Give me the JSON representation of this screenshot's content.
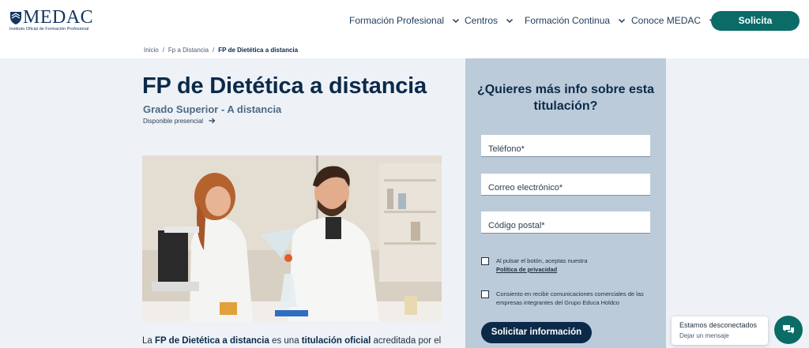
{
  "header": {
    "logo": {
      "word": "MEDAC",
      "tagline": "Instituto Oficial de Formación Profesional"
    },
    "nav": [
      {
        "label": "Formación Profesional"
      },
      {
        "label": "Centros"
      },
      {
        "label": "Formación Continua"
      },
      {
        "label": "Conoce MEDAC"
      }
    ],
    "cta_label": "Solicita información"
  },
  "breadcrumb": {
    "items": [
      "Inicio",
      "Fp a Distancia",
      "FP de Dietética a distancia"
    ],
    "separator": "/"
  },
  "main": {
    "title": "FP de Dietética a distancia",
    "subtitle": "Grado Superior - A distancia",
    "availability": "Disponible presencial",
    "intro": {
      "p1": "La ",
      "b1": "FP de Dietética a distancia",
      "p2": " es una ",
      "b2": "titulación oficial",
      "p3": " acreditada por el"
    }
  },
  "form": {
    "title": "¿Quieres más info sobre esta titulación?",
    "phone_placeholder": "Teléfono*",
    "email_placeholder": "Correo electrónico*",
    "postal_placeholder": "Código postal*",
    "consent_privacy": "Al pulsar el botón, aceptas nuestra",
    "privacy_link": "Política de privacidad",
    "consent_comms": "Consiento en recibir comunicaciones comerciales de las empresas integrantes del Grupo Educa Holdco",
    "submit_label": "Solicitar información"
  },
  "chat": {
    "title": "Estamos desconectados",
    "subtitle": "Dejar un mensaje"
  },
  "colors": {
    "navy": "#0b2a4a",
    "teal": "#0b6b67",
    "panel": "#bccbd9",
    "background": "#eef2f7"
  },
  "icons": [
    "shield-logo-icon",
    "chevron-down-icon",
    "arrow-right-icon",
    "chat-bubble-icon"
  ]
}
